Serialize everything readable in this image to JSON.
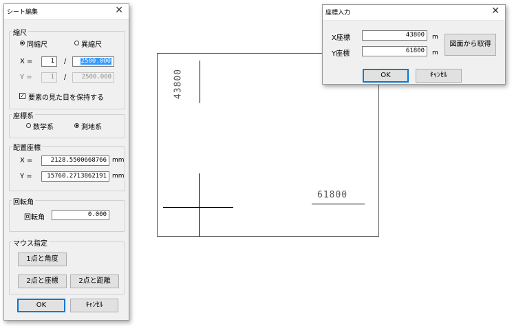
{
  "sheet_dialog": {
    "title": "シート編集",
    "close": "✕",
    "scale": {
      "legend": "縮尺",
      "same_label": "同縮尺",
      "diff_label": "異縮尺",
      "x_label": "X =",
      "x_num": "1",
      "slash": "/",
      "x_den": "2500.000",
      "y_label": "Y =",
      "y_num": "1",
      "y_den": "2500.000",
      "keep_label": "要素の見た目を保持する",
      "keep_mark": "✓"
    },
    "coord": {
      "legend": "座標系",
      "math_label": "数学系",
      "survey_label": "測地系"
    },
    "placement": {
      "legend": "配置座標",
      "x_label": "X =",
      "x_value": "2128.5500668766",
      "y_label": "Y =",
      "y_value": "15760.2713862191",
      "unit": "mm"
    },
    "rotation": {
      "legend": "回転角",
      "label": "回転角",
      "value": "0.000"
    },
    "mouse": {
      "legend": "マウス指定",
      "btn1": "1点と角度",
      "btn2": "2点と座標",
      "btn3": "2点と距離"
    },
    "ok": "OK",
    "cancel": "ｷｬﾝｾﾙ"
  },
  "coord_dialog": {
    "title": "座標入力",
    "close": "✕",
    "x_label": "X座標",
    "x_value": "43800",
    "y_label": "Y座標",
    "y_value": "61800",
    "unit": "m",
    "get_button": "図面から取得",
    "ok": "OK",
    "cancel": "ｷｬﾝｾﾙ"
  },
  "drawing": {
    "label_vertical": "43800",
    "label_horizontal": "61800"
  }
}
